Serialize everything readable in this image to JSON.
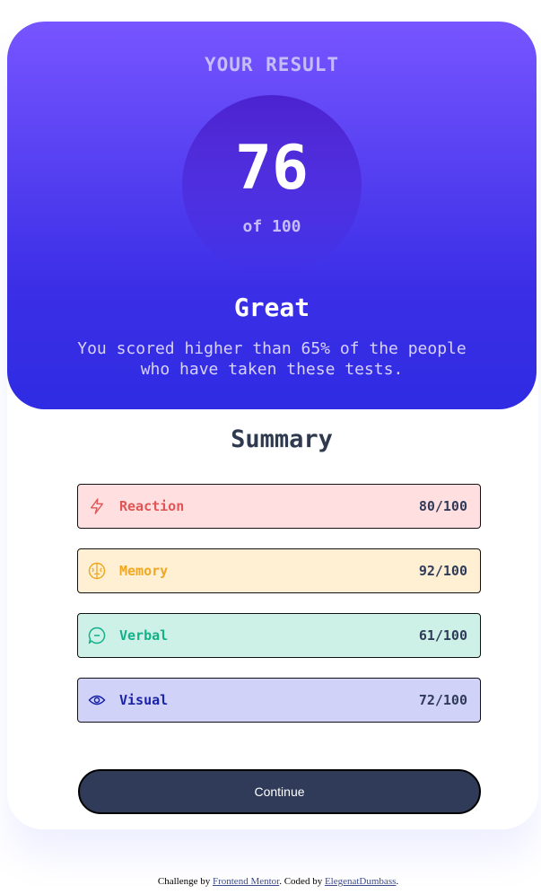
{
  "result": {
    "heading": "YOUR RESULT",
    "score": "76",
    "out_of": "of 100",
    "grade": "Great",
    "message": "You scored higher than 65% of the people who have taken these tests."
  },
  "summary": {
    "title": "Summary",
    "items": [
      {
        "label": "Reaction",
        "value": "80/100",
        "icon": "lightning-icon",
        "color": "#e05555",
        "bg": "#ffdfe0"
      },
      {
        "label": "Memory",
        "value": "92/100",
        "icon": "brain-icon",
        "color": "#f0a822",
        "bg": "#ffefd3"
      },
      {
        "label": "Verbal",
        "value": "61/100",
        "icon": "speech-bubble-icon",
        "color": "#14b08a",
        "bg": "#cdf1e7"
      },
      {
        "label": "Visual",
        "value": "72/100",
        "icon": "eye-icon",
        "color": "#1a22a8",
        "bg": "#d0d3f7"
      }
    ]
  },
  "continue_label": "Continue",
  "attribution": {
    "prefix": "Challenge by ",
    "link1": "Frontend Mentor",
    "middle": ". Coded by ",
    "link2": "ElegenatDumbass",
    "suffix": "."
  },
  "colors": {
    "gradient_top": "#7755ff",
    "gradient_bottom": "#2f2ce3",
    "button": "#303b5a"
  }
}
